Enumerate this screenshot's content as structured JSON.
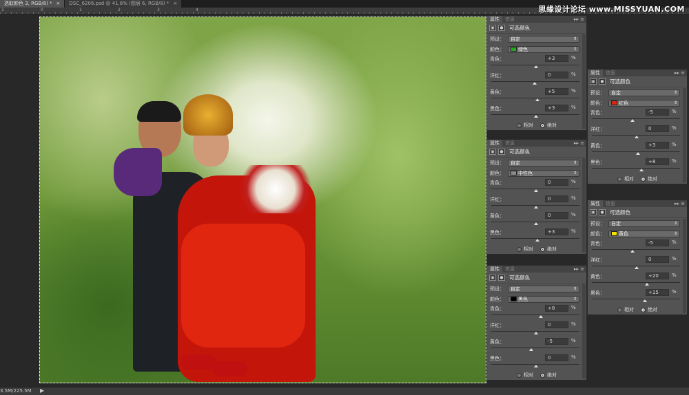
{
  "tabs": [
    {
      "label": "选取颜色 3, RGB/8) *",
      "close": "×",
      "active": true
    },
    {
      "label": "DSC_6206.psd @ 41.8% (图层 6, RGB/8) *",
      "close": "×",
      "active": false
    }
  ],
  "ruler": [
    "1",
    "0",
    "1",
    "2",
    "3",
    "4"
  ],
  "watermark": "思缘设计论坛 www.MISSYUAN.COM",
  "status": {
    "memory": "3.5M/225.5M",
    "arrow": "▶"
  },
  "panel_common": {
    "tab1": "属性",
    "tab2": "信息",
    "menu": "▸▸ ≡",
    "title": "可选颜色",
    "preset_label": "预设：",
    "preset_value": "自定",
    "color_label": "颜色：",
    "relative": "相对",
    "absolute": "绝对",
    "pct": "%",
    "sliders": [
      "青色：",
      "洋红：",
      "黄色：",
      "黑色："
    ]
  },
  "panels": [
    {
      "color_name": "绿色",
      "color_hex": "#22a81a",
      "values": [
        "+3",
        "0",
        "+5",
        "+3"
      ],
      "mode": "absolute"
    },
    {
      "color_name": "中性色",
      "color_hex": "#8a8a8a",
      "values": [
        "0",
        "0",
        "0",
        "+3"
      ],
      "mode": "absolute"
    },
    {
      "color_name": "黑色",
      "color_hex": "#000000",
      "values": [
        "+8",
        "0",
        "-5",
        "0"
      ],
      "mode": "absolute"
    },
    {
      "color_name": "红色",
      "color_hex": "#d8280f",
      "values": [
        "-5",
        "0",
        "+3",
        "+8"
      ],
      "mode": "absolute"
    },
    {
      "color_name": "黄色",
      "color_hex": "#f2e200",
      "values": [
        "-5",
        "0",
        "+20",
        "+15"
      ],
      "mode": "absolute"
    }
  ]
}
